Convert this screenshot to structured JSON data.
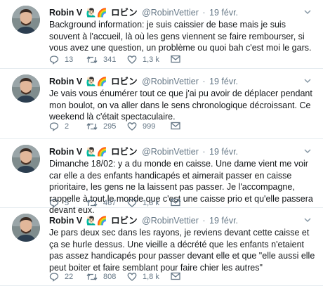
{
  "author": {
    "name": "Robin V",
    "emoji": "🙋🏻‍♂️🌈",
    "kana": "ロビン",
    "handle": "@RobinVettier",
    "separator": "·",
    "date": "19 févr."
  },
  "tweets": [
    {
      "text": "Background information: je suis caissier de base mais je suis souvent à l'accueil, là où les gens viennent se faire rembourser, si vous avez une question, un problème ou quoi bah c'est moi le gars.",
      "replies": "13",
      "retweets": "341",
      "likes": "1,3 k"
    },
    {
      "text": "Je vais vous énumérer tout ce que j'ai pu avoir de déplacer pendant mon boulot, on va aller dans le sens chronologique décroissant. Ce weekend là c'était spectaculaire.",
      "replies": "2",
      "retweets": "295",
      "likes": "999"
    },
    {
      "text": "Dimanche 18/02: y a du monde en caisse. Une dame vient me voir car elle a des enfants handicapés et aimerait passer en caisse prioritaire, les gens ne la laissent pas passer. Je l'accompagne, rappelle à tout le monde que c'est une caisse prio et qu'elle passera devant eux.",
      "replies": "5",
      "retweets": "467",
      "likes": "1,3 k"
    },
    {
      "text": "Je pars deux sec dans les rayons, je reviens devant cette caisse et ça se hurle dessus. Une vieille a décrété que les enfants n'etaient pas assez handicapés pour passer devant elle et que \"elle aussi elle peut boiter et faire semblant pour faire chier les autres\"",
      "replies": "22",
      "retweets": "808",
      "likes": "1,8 k"
    }
  ]
}
